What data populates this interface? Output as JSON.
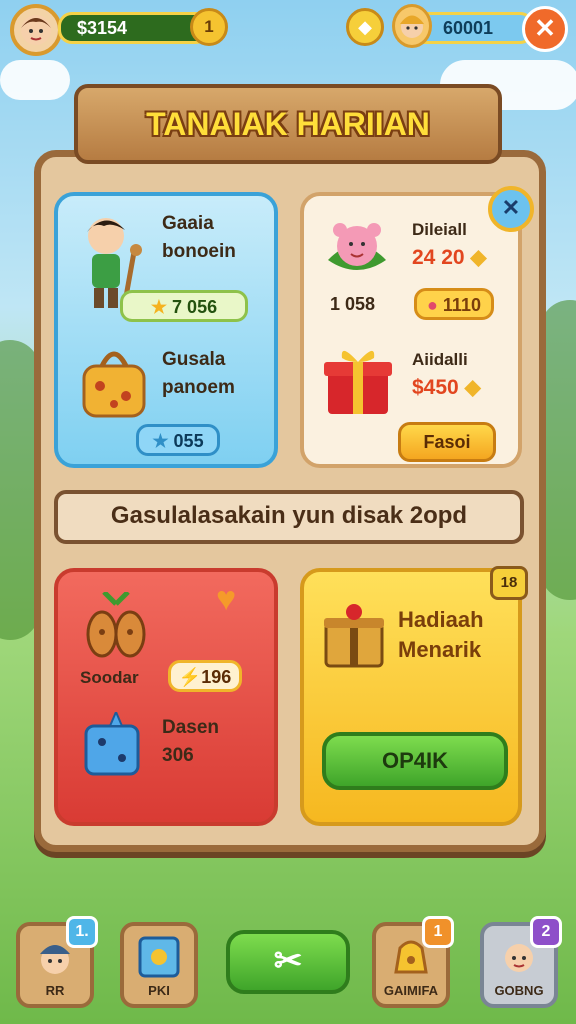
{
  "top_bar": {
    "coins_value": "$3154",
    "coins_badge": "1",
    "gold_value": "60001",
    "close_label": "✕"
  },
  "title": "TANAIAK HARIIAN",
  "cards": {
    "blue": {
      "item1_label_line1": "Gaaia",
      "item1_label_line2": "bonoein",
      "item1_value": "7 056",
      "item2_label_line1": "Gusala",
      "item2_label_line2": "panoem",
      "item2_value": "055"
    },
    "cream": {
      "item1_name": "Dileiall",
      "item1_price": "24 20",
      "item1_count": "1 058",
      "item1_badge_value": "1110",
      "item2_name": "Aiidalli",
      "item2_price": "$450",
      "button_label": "Fasoi"
    },
    "red": {
      "item1_label": "Soodar",
      "item1_value": "196",
      "item2_label_line1": "Dasen",
      "item2_label_line2": "306"
    },
    "yellow": {
      "corner_badge": "18",
      "title_line1": "Hadiaah",
      "title_line2": "Menarik",
      "button_label": "OP4IK"
    }
  },
  "banner_text": "Gasulalasakain yun disak 2opd",
  "bottom_bar": [
    {
      "label": "RR",
      "badge": "1."
    },
    {
      "label": "PKI",
      "badge": ""
    },
    {
      "label": "",
      "badge": ""
    },
    {
      "label": "GAIMIFA",
      "badge": "1"
    },
    {
      "label": "GOBNG",
      "badge": "2"
    }
  ],
  "colors": {
    "accent_green": "#3fa52a",
    "board_brown": "#9a6a3b",
    "title_yellow": "#ffde3a"
  }
}
